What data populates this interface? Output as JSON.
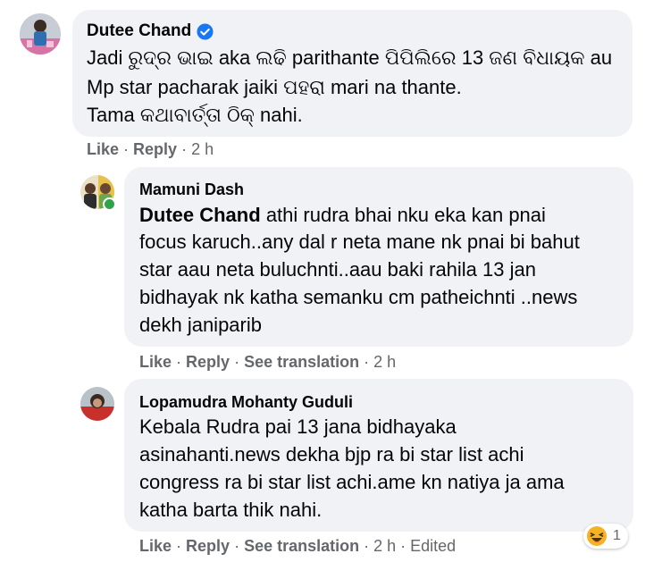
{
  "comments": [
    {
      "author": "Dutee Chand",
      "verified": true,
      "lines": [
        "Jadi ରୁଦ୍ର ଭାଇ aka ଲଢି parithante ପିପିଲିରେ 13 ଜଣ ବିଧାୟକ au",
        "Mp star pacharak jaiki ପହରା mari na thante.",
        "Tama କଥାବାର୍ତ୍ତା ଠିକ୍ nahi."
      ],
      "actions": {
        "like": "Like",
        "reply": "Reply",
        "time": "2 h"
      }
    },
    {
      "author": "Mamuni Dash",
      "mention": "Dutee Chand",
      "lines": [
        "athi rudra bhai nku eka kan pnai",
        "focus karuch..any dal r neta mane nk pnai bi bahut",
        "star aau neta buluchnti..aau baki rahila 13 jan",
        "bidhayak nk katha semanku cm patheichnti ..news",
        "dekh janiparib"
      ],
      "actions": {
        "like": "Like",
        "reply": "Reply",
        "translate": "See translation",
        "time": "2 h"
      }
    },
    {
      "author": "Lopamudra Mohanty Guduli",
      "lines": [
        "Kebala Rudra pai 13 jana bidhayaka",
        "asinahanti.news dekha bjp ra bi star list achi",
        "congress ra bi star list achi.ame kn natiya ja ama",
        "katha barta thik nahi."
      ],
      "actions": {
        "like": "Like",
        "reply": "Reply",
        "translate": "See translation",
        "time": "2 h",
        "edited": "Edited"
      },
      "reaction": {
        "icon": "haha-emoji-icon",
        "count": "1"
      }
    }
  ],
  "colors": {
    "bubble": "#f0f2f5",
    "meta_text": "#65676b",
    "verified": "#1877f2",
    "online": "#31a24c",
    "haha": "#f7b125"
  }
}
